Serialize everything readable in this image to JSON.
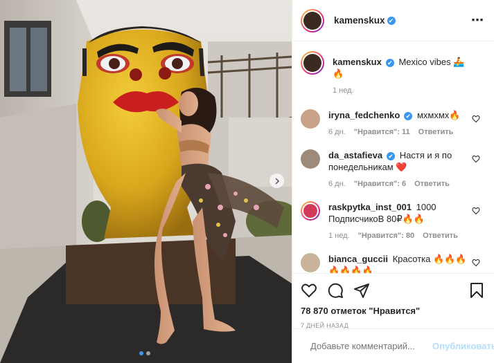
{
  "post": {
    "username": "kamenskux",
    "verified_mark": "✔",
    "more_icon": "⋯",
    "caption": "Mexico vibes 🚣🔥",
    "caption_time": "1 нед."
  },
  "comments": [
    {
      "username": "iryna_fedchenko",
      "verified": true,
      "text": "мхмхмх🔥",
      "time": "6 дн.",
      "likes": "\"Нравится\": 11",
      "reply": "Ответить",
      "avatar_color": "#c9a28a"
    },
    {
      "username": "da_astafieva",
      "verified": true,
      "text": "Настя и я по понедельникам ❤️",
      "time": "6 дн.",
      "likes": "\"Нравится\": 6",
      "reply": "Ответить",
      "avatar_color": "#9c8b7a"
    },
    {
      "username": "raskpytka_inst_001",
      "verified": false,
      "text": "1000 ПодписчикоВ 80₽🔥🔥",
      "time": "1 нед.",
      "likes": "\"Нравится\": 80",
      "reply": "Ответить",
      "avatar_color": "#d23a5a"
    },
    {
      "username": "bianca_guccii",
      "verified": false,
      "text": "Красотка 🔥🔥🔥🔥🔥🔥🔥",
      "time": "",
      "likes": "",
      "reply": "",
      "avatar_color": "#c8b49a"
    }
  ],
  "likes_text": "78 870 отметок \"Нравится\"",
  "date_text": "7 дней назад",
  "add_comment": {
    "placeholder": "Добавьте комментарий...",
    "post_label": "Опубликовать"
  },
  "icons": [
    "heart-icon",
    "comment-icon",
    "share-icon",
    "bookmark-icon",
    "emoji-icon",
    "chevron-right-icon"
  ],
  "colors": {
    "accent": "#3897f0",
    "post_disabled": "#b2dffc",
    "muted": "#8e8e8e"
  }
}
